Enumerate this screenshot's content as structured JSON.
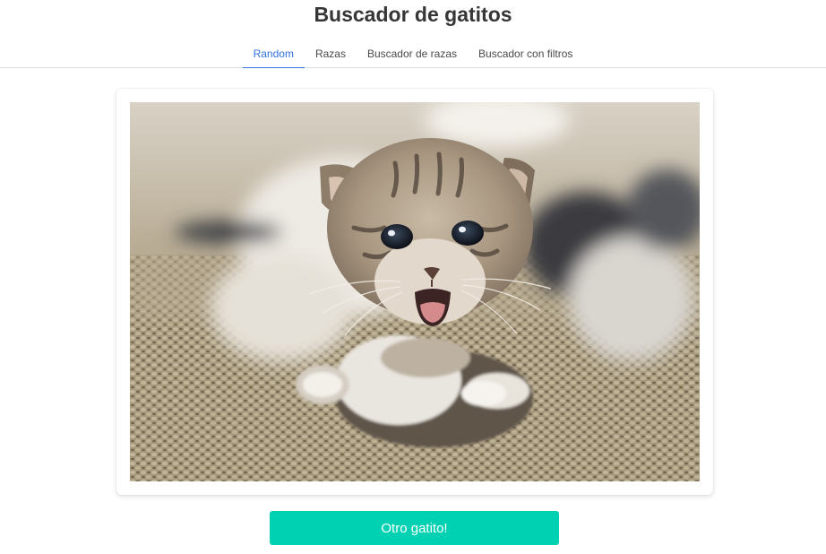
{
  "header": {
    "title": "Buscador de gatitos"
  },
  "tabs": [
    {
      "label": "Random",
      "active": true
    },
    {
      "label": "Razas",
      "active": false
    },
    {
      "label": "Buscador de razas",
      "active": false
    },
    {
      "label": "Buscador con filtros",
      "active": false
    }
  ],
  "photo": {
    "alt": "kitten"
  },
  "actions": {
    "next_label": "Otro gatito!"
  },
  "colors": {
    "accent": "#3273dc",
    "button": "#00d1b2",
    "title": "#363636"
  }
}
